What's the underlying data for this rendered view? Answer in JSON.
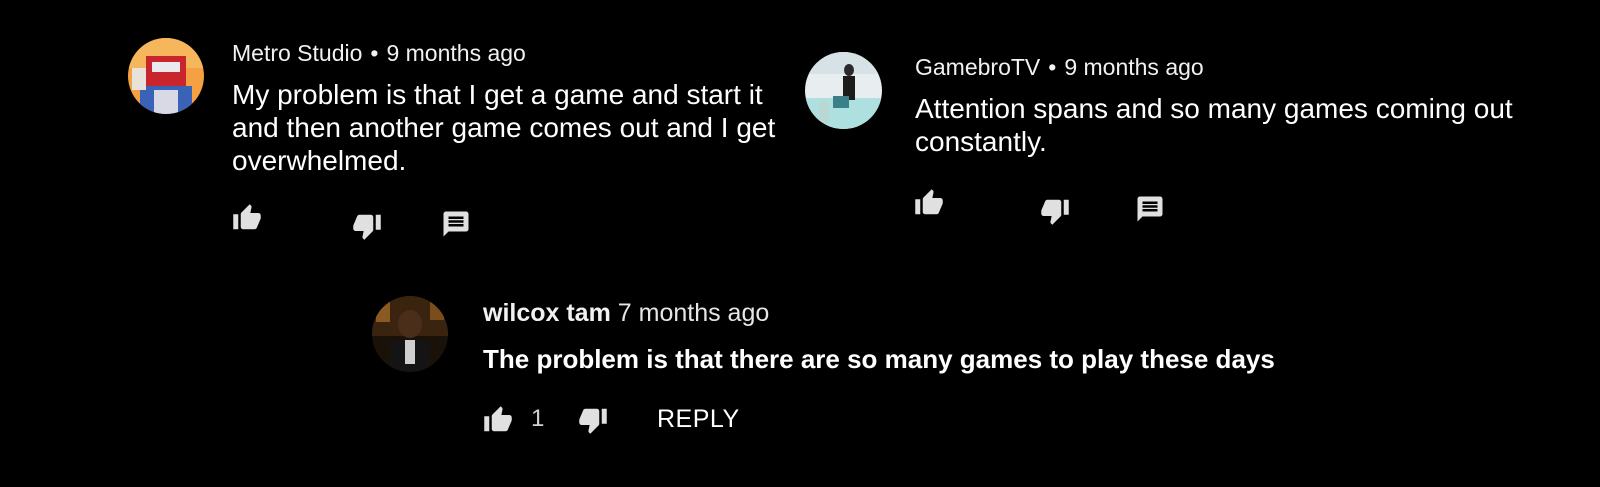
{
  "comments": [
    {
      "author": "Metro Studio",
      "separator": "•",
      "time": "9 months ago",
      "text": "My problem is that I get a game and start it and then another game comes out and I get overwhelmed."
    },
    {
      "author": "GamebroTV",
      "separator": "•",
      "time": "9 months ago",
      "text": "Attention spans and so many games coming out constantly."
    },
    {
      "author": "wilcox tam",
      "time": "7 months ago",
      "text": "The problem is that there are so many games to play these days",
      "like_count": "1",
      "reply_label": "REPLY"
    }
  ],
  "icons": [
    "thumb-up-icon",
    "thumb-down-icon",
    "reply-icon"
  ],
  "colors": {
    "background": "#000000",
    "text": "#ffffff",
    "icon": "#e0e0e0"
  }
}
